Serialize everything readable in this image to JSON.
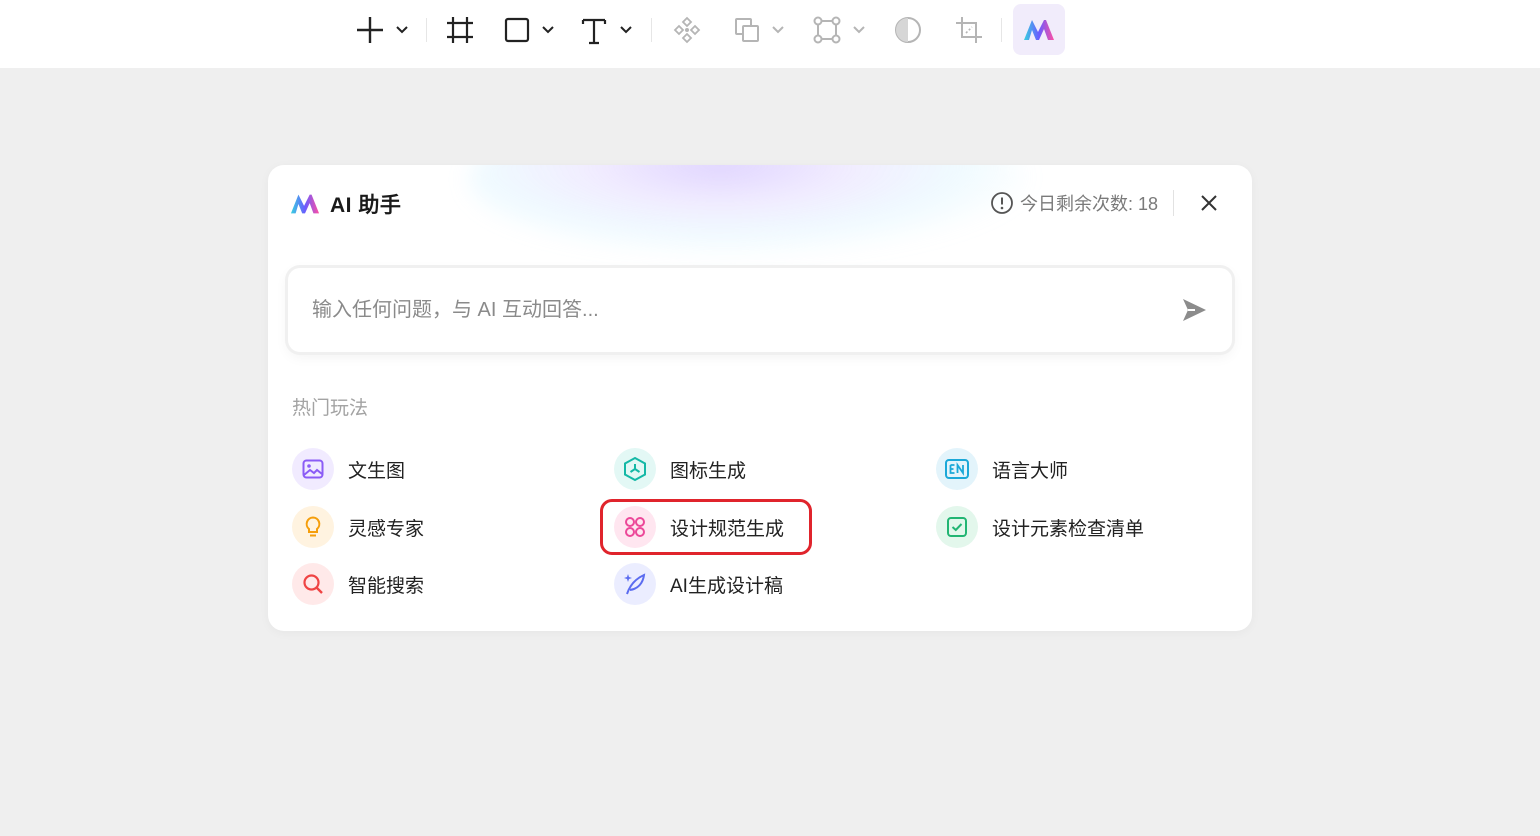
{
  "toolbar": {
    "tools": [
      {
        "icon": "plus-icon",
        "has_dropdown": true
      },
      {
        "icon": "frame-icon",
        "has_dropdown": false
      },
      {
        "icon": "rectangle-icon",
        "has_dropdown": true
      },
      {
        "icon": "text-icon",
        "has_dropdown": true
      },
      {
        "icon": "component-icon",
        "has_dropdown": false
      },
      {
        "icon": "boolean-icon",
        "has_dropdown": true
      },
      {
        "icon": "vector-icon",
        "has_dropdown": true
      },
      {
        "icon": "contrast-icon",
        "has_dropdown": false
      },
      {
        "icon": "crop-icon",
        "has_dropdown": false
      },
      {
        "icon": "ai-logo-icon",
        "has_dropdown": false
      }
    ]
  },
  "panel": {
    "title": "AI 助手",
    "quota_text": "今日剩余次数: 18",
    "input_placeholder": "输入任何问题，与 AI 互动回答...",
    "section_label": "热门玩法",
    "features": [
      {
        "label": "文生图",
        "icon": "image-icon",
        "color": "#8b5cf6"
      },
      {
        "label": "图标生成",
        "icon": "hexagon-icon",
        "color": "#14b8a6"
      },
      {
        "label": "语言大师",
        "icon": "en-icon",
        "color": "#1ba8d8"
      },
      {
        "label": "灵感专家",
        "icon": "lightbulb-icon",
        "color": "#f59e0b"
      },
      {
        "label": "设计规范生成",
        "icon": "grid-circles-icon",
        "color": "#ec4899"
      },
      {
        "label": "设计元素检查清单",
        "icon": "checkbox-icon",
        "color": "#22b573"
      },
      {
        "label": "智能搜索",
        "icon": "search-icon",
        "color": "#ef4444"
      },
      {
        "label": "AI生成设计稿",
        "icon": "quill-icon",
        "color": "#5b6cf0"
      }
    ],
    "highlighted_feature": "设计规范生成"
  }
}
